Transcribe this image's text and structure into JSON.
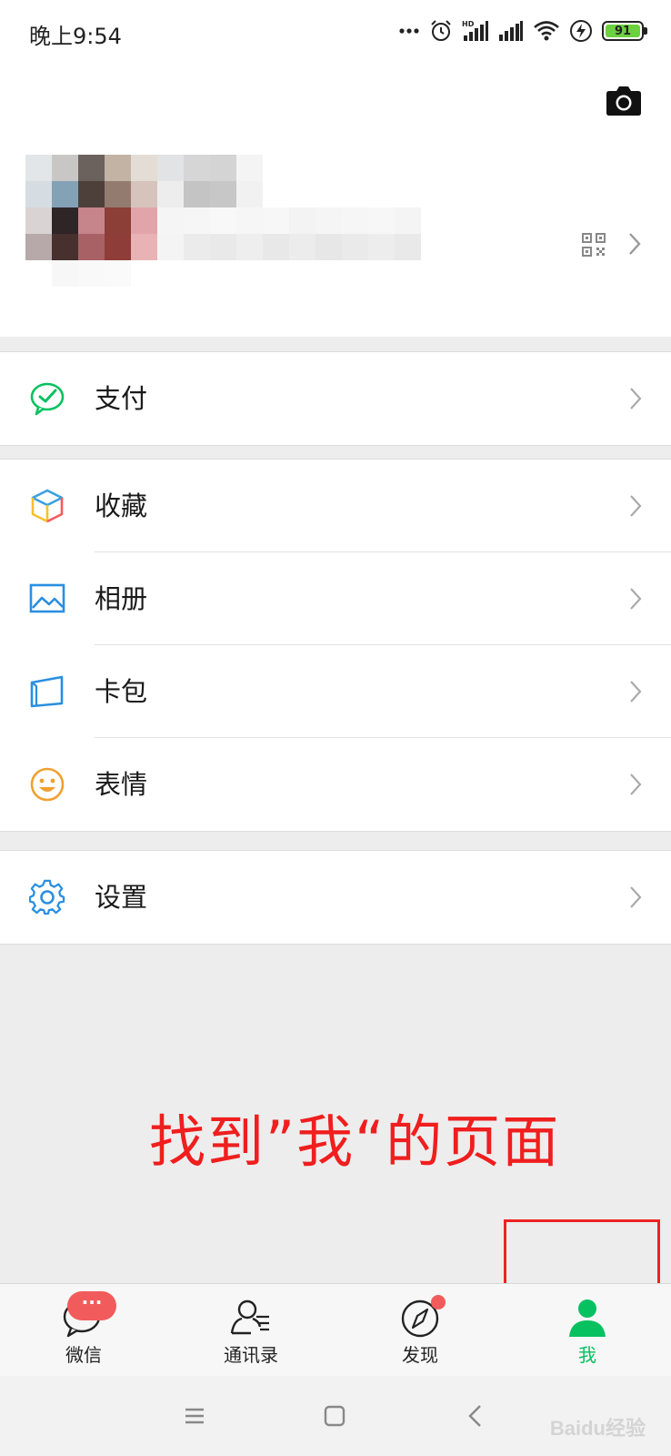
{
  "status_bar": {
    "time": "晚上9:54",
    "battery": "91",
    "icons": [
      "dots-icon",
      "alarm-icon",
      "hd-signal-icon",
      "signal-icon",
      "wifi-icon",
      "charging-icon",
      "battery-icon"
    ]
  },
  "profile": {
    "camera_icon": "camera-icon",
    "qr_icon": "qr-code-icon",
    "arrow_icon": "chevron-right-icon"
  },
  "groups": {
    "pay": {
      "label": "支付",
      "icon": "wechat-pay-icon"
    },
    "favorites": {
      "label": "收藏",
      "icon": "favorites-cube-icon"
    },
    "album": {
      "label": "相册",
      "icon": "album-icon"
    },
    "cards": {
      "label": "卡包",
      "icon": "card-wallet-icon"
    },
    "stickers": {
      "label": "表情",
      "icon": "smile-icon"
    },
    "settings": {
      "label": "设置",
      "icon": "gear-icon"
    }
  },
  "annotation": {
    "text": "找到”我“的页面",
    "color": "#f01e1e"
  },
  "tabs": {
    "chats": {
      "label": "微信",
      "badge": "···"
    },
    "contacts": {
      "label": "通讯录"
    },
    "discover": {
      "label": "发现"
    },
    "me": {
      "label": "我"
    }
  },
  "nav": [
    "menu-icon",
    "home-icon",
    "back-icon"
  ],
  "watermark": "Baidu经验",
  "colors": {
    "accent": "#07c160",
    "badge": "#f25b5b",
    "annotation": "#f01e1e"
  }
}
